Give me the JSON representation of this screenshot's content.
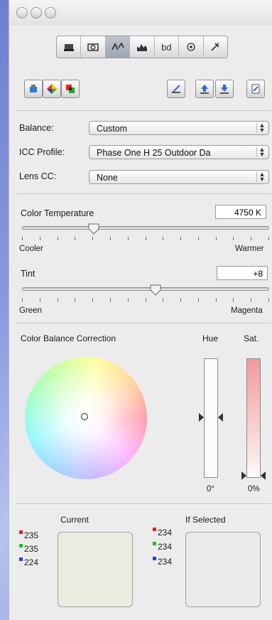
{
  "toolbar_tabs": [
    {
      "icon": "camera-body-icon"
    },
    {
      "icon": "camera-icon"
    },
    {
      "icon": "color-adjust-icon"
    },
    {
      "icon": "histogram-icon"
    },
    {
      "icon": "bd-text-icon",
      "text": "bd"
    },
    {
      "icon": "flower-icon"
    },
    {
      "icon": "pin-icon"
    }
  ],
  "balance": {
    "label": "Balance:",
    "value": "Custom"
  },
  "icc_profile": {
    "label": "ICC Profile:",
    "value": "Phase One H 25 Outdoor Da"
  },
  "lens_cc": {
    "label": "Lens CC:",
    "value": "None"
  },
  "color_temperature": {
    "label": "Color Temperature",
    "value": "4750 K",
    "left": "Cooler",
    "right": "Warmer",
    "level": 0.29
  },
  "tint": {
    "label": "Tint",
    "value": "+8",
    "left": "Green",
    "right": "Magenta",
    "level": 0.54
  },
  "color_balance": {
    "label": "Color Balance Correction",
    "hue_label": "Hue",
    "sat_label": "Sat.",
    "hue_value": "0°",
    "sat_value": "0%"
  },
  "current": {
    "label": "Current",
    "r": "235",
    "g": "235",
    "b": "224",
    "swatch": "#ebebe0"
  },
  "if_selected": {
    "label": "If Selected",
    "r": "234",
    "g": "234",
    "b": "234",
    "swatch": "#eaeaea"
  },
  "colors": {
    "red": "#e02020",
    "green": "#20c020",
    "blue": "#2040e0"
  }
}
